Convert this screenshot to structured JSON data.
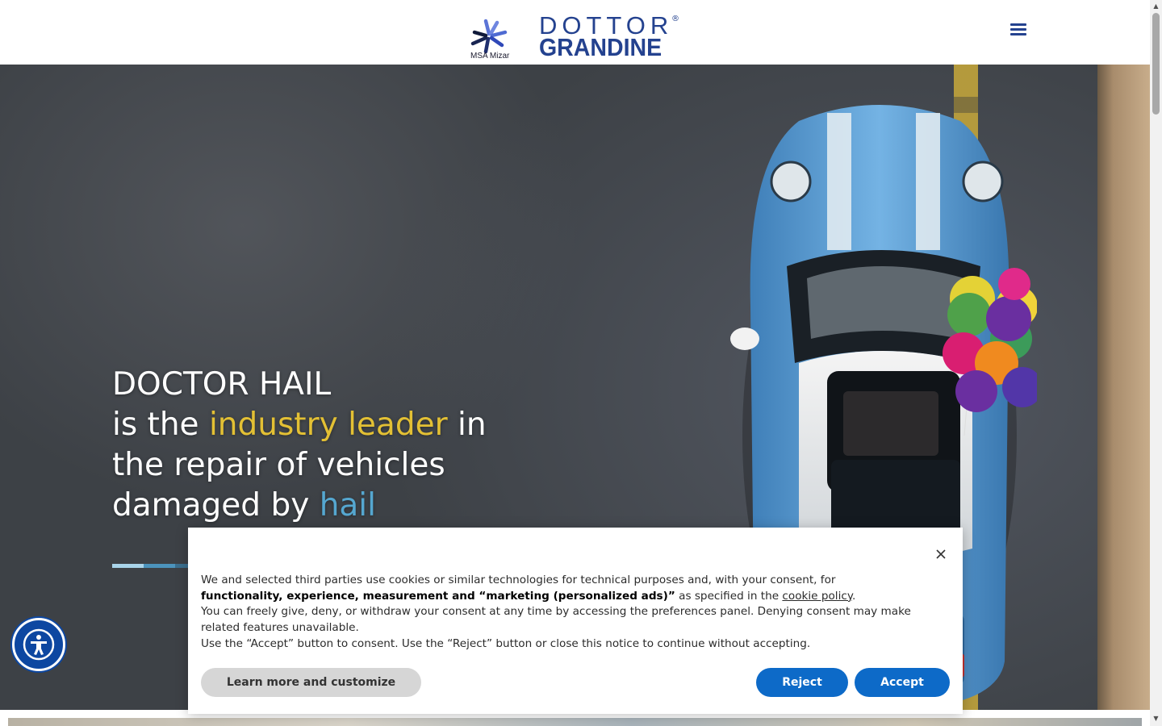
{
  "header": {
    "msa_logo_text": "MSA Mizar",
    "brand_top": "DOTTOR",
    "brand_bottom": "GRANDINE",
    "brand_registered": "®",
    "menu_icon": "hamburger-menu-icon"
  },
  "hero": {
    "line1": "DOCTOR HAIL",
    "line2_prefix": "is the ",
    "line2_highlight": "industry leader",
    "line2_suffix": " in",
    "line3": "the repair of vehicles",
    "line4_prefix": "damaged by ",
    "line4_highlight": "hail"
  },
  "accessibility": {
    "icon": "accessibility-icon"
  },
  "cookie_banner": {
    "close_icon": "close-icon",
    "p1_prefix": "We and selected third parties use cookies or similar technologies for technical purposes and, with your consent, for ",
    "p1_bold": "functionality, experience, measurement and “marketing (personalized ads)”",
    "p1_mid": " as specified in the ",
    "p1_link": "cookie policy",
    "p1_end": ".",
    "p2": "You can freely give, deny, or withdraw your consent at any time by accessing the preferences panel. Denying consent may make related features unavailable.",
    "p3": "Use the “Accept” button to consent. Use the “Reject” button or close this notice to continue without accepting.",
    "learn_label": "Learn more and customize",
    "reject_label": "Reject",
    "accept_label": "Accept"
  },
  "colors": {
    "brand_blue": "#24428f",
    "highlight_yellow": "#e3c034",
    "highlight_blue": "#55a7d0",
    "button_blue": "#0d6ac8",
    "accessibility_blue": "#0d47a1"
  }
}
